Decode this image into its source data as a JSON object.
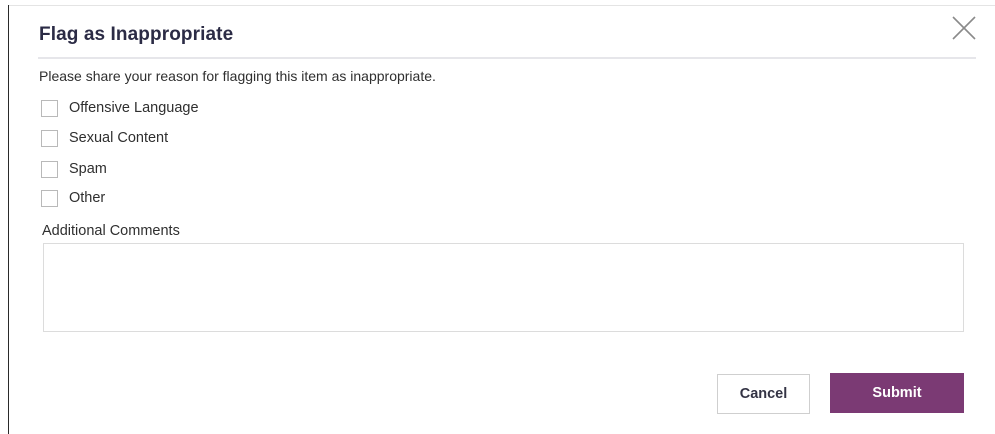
{
  "dialog": {
    "title": "Flag as Inappropriate",
    "prompt": "Please share your reason for flagging this item as inappropriate.",
    "options": [
      {
        "label": "Offensive Language",
        "checked": false
      },
      {
        "label": "Sexual Content",
        "checked": false
      },
      {
        "label": "Spam",
        "checked": false
      },
      {
        "label": "Other",
        "checked": false
      }
    ],
    "comments_label": "Additional Comments",
    "comments_value": "",
    "cancel_label": "Cancel",
    "submit_label": "Submit",
    "close_icon": "close-icon"
  },
  "colors": {
    "accent": "#7b3a74",
    "title": "#2b2b45"
  }
}
